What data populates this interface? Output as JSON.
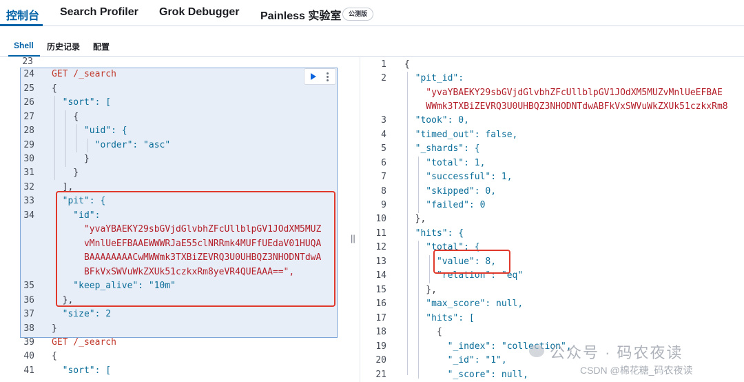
{
  "top_tabs": [
    {
      "label": "控制台",
      "active": true
    },
    {
      "label": "Search Profiler",
      "active": false
    },
    {
      "label": "Grok Debugger",
      "active": false
    },
    {
      "label": "Painless 实验室",
      "active": false
    }
  ],
  "beta_badge": "公测版",
  "sub_tabs": [
    {
      "label": "Shell",
      "active": true
    },
    {
      "label": "历史记录",
      "active": false
    },
    {
      "label": "配置",
      "active": false
    }
  ],
  "request_editor": {
    "line_numbers": [
      "23",
      "24",
      "25",
      "26",
      "27",
      "28",
      "29",
      "30",
      "31",
      "32",
      "33",
      "34",
      "",
      "",
      "",
      "35",
      "36",
      "37",
      "38",
      "39",
      "40",
      "41"
    ],
    "lines": [
      "",
      "GET /_search",
      "{",
      "  \"sort\": [",
      "    {",
      "      \"uid\": {",
      "        \"order\": \"asc\"",
      "      }",
      "    }",
      "  ],",
      "  \"pit\": {",
      "    \"id\":",
      "      \"yvaYBAEKY29sbGVjdGlvbhZFcUllblpGV1JOdXM5MUZ",
      "      vMnlUeEFBAAEWWWRJaE55clNRRmk4MUFfUEdaV01HUQA",
      "      BAAAAAAAACwMWWmk3TXBiZEVRQ3U0UHBQZ3NHODNTdwA",
      "      BFkVxSWVuWkZXUk51czkxRm8yeVR4QUEAAA==\",",
      "    \"keep_alive\": \"10m\"",
      "  },",
      "  \"size\": 2",
      "}",
      "GET /_search",
      "{",
      "  \"sort\": ["
    ]
  },
  "response_viewer": {
    "line_numbers": [
      "1",
      "2",
      "",
      "3",
      "4",
      "5",
      "6",
      "7",
      "8",
      "9",
      "10",
      "11",
      "12",
      "13",
      "14",
      "15",
      "16",
      "17",
      "18",
      "19",
      "20",
      "21"
    ],
    "lines": [
      "{",
      "  \"pit_id\":",
      "    \"yvaYBAEKY29sbGVjdGlvbhZFcUllblpGV1JOdXM5MUZvMnlUeEFBAE",
      "    WWmk3TXBiZEVRQ3U0UHBQZ3NHODNTdwABFkVxSWVuWkZXUk51czkxRm8",
      "  \"took\": 0,",
      "  \"timed_out\": false,",
      "  \"_shards\": {",
      "    \"total\": 1,",
      "    \"successful\": 1,",
      "    \"skipped\": 0,",
      "    \"failed\": 0",
      "  },",
      "  \"hits\": {",
      "    \"total\": {",
      "      \"value\": 8,",
      "      \"relation\": \"eq\"",
      "    },",
      "    \"max_score\": null,",
      "    \"hits\": [",
      "      {",
      "        \"_index\": \"collection\",",
      "        \"_id\": \"1\",",
      "        \"_score\": null,"
    ]
  },
  "divider_label": "||",
  "watermark": "公众号 · 码农夜读",
  "watermark_csdn": "CSDN @棉花糖_码农夜读",
  "colors": {
    "accent": "#0061a6",
    "highlight": "#e0392b",
    "selection": "#e8eef7"
  }
}
